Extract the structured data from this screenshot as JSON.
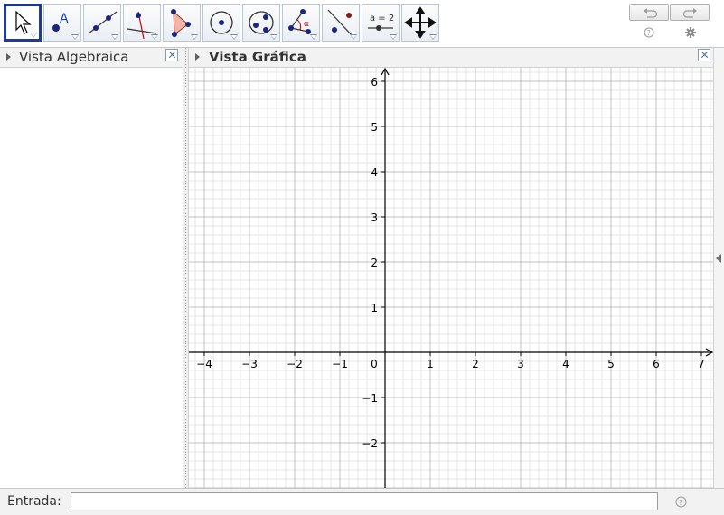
{
  "toolbar": {
    "tools": [
      {
        "name": "move-tool",
        "selected": true
      },
      {
        "name": "point-tool",
        "label": "A"
      },
      {
        "name": "line-tool"
      },
      {
        "name": "perpendicular-line-tool"
      },
      {
        "name": "polygon-tool"
      },
      {
        "name": "circle-tool"
      },
      {
        "name": "conic-tool"
      },
      {
        "name": "angle-tool",
        "label": "α"
      },
      {
        "name": "reflect-tool"
      },
      {
        "name": "slider-tool",
        "label": "a = 2"
      },
      {
        "name": "move-graphics-view-tool"
      }
    ],
    "undo_icon": "undo-icon",
    "redo_icon": "redo-icon",
    "help_icon": "help-icon",
    "settings_icon": "gear-icon"
  },
  "algebra_view": {
    "title": "Vista Algebraica"
  },
  "graphics_view": {
    "title": "Vista Gráfica",
    "x_ticks": [
      "-4",
      "-3",
      "-2",
      "-1",
      "0",
      "1",
      "2",
      "3",
      "4",
      "5",
      "6",
      "7"
    ],
    "y_ticks_pos": [
      "1",
      "2",
      "3",
      "4",
      "5",
      "6"
    ],
    "y_ticks_neg": [
      "-1",
      "-2"
    ]
  },
  "input_bar": {
    "label": "Entrada:",
    "value": "",
    "placeholder": ""
  },
  "colors": {
    "selected_tool_border": "#1a3d9a",
    "grid_major": "#c0c0c0",
    "grid_minor": "#e6e6e6",
    "point": "#1a237e"
  }
}
